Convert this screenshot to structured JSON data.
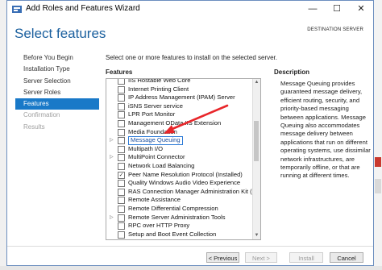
{
  "window": {
    "title": "Add Roles and Features Wizard",
    "page_title": "Select features",
    "destination_label": "DESTINATION SERVER",
    "controls": {
      "minimize": "—",
      "maximize": "☐",
      "close": "✕"
    }
  },
  "nav": {
    "items": [
      {
        "label": "Before You Begin",
        "state": "normal"
      },
      {
        "label": "Installation Type",
        "state": "normal"
      },
      {
        "label": "Server Selection",
        "state": "normal"
      },
      {
        "label": "Server Roles",
        "state": "normal"
      },
      {
        "label": "Features",
        "state": "selected"
      },
      {
        "label": "Confirmation",
        "state": "disabled"
      },
      {
        "label": "Results",
        "state": "disabled"
      }
    ]
  },
  "main": {
    "instruction": "Select one or more features to install on the selected server.",
    "features_header": "Features",
    "description_header": "Description",
    "description_text": "Message Queuing provides guaranteed message delivery, efficient routing, security, and priority-based messaging between applications. Message Queuing also accommodates message delivery between applications that run on different operating systems, use dissimilar network infrastructures, are temporarily offline, or that are running at different times."
  },
  "features": [
    {
      "label": "IIS Hostable Web Core",
      "checked": false,
      "expandable": false
    },
    {
      "label": "Internet Printing Client",
      "checked": false,
      "expandable": false
    },
    {
      "label": "IP Address Management (IPAM) Server",
      "checked": false,
      "expandable": false
    },
    {
      "label": "iSNS Server service",
      "checked": false,
      "expandable": false
    },
    {
      "label": "LPR Port Monitor",
      "checked": false,
      "expandable": false
    },
    {
      "label": "Management OData IIS Extension",
      "checked": false,
      "expandable": false
    },
    {
      "label": "Media Foundation",
      "checked": false,
      "expandable": false
    },
    {
      "label": "Message Queuing",
      "checked": false,
      "expandable": true,
      "highlighted": true
    },
    {
      "label": "Multipath I/O",
      "checked": false,
      "expandable": false
    },
    {
      "label": "MultiPoint Connector",
      "checked": false,
      "expandable": true
    },
    {
      "label": "Network Load Balancing",
      "checked": false,
      "expandable": false
    },
    {
      "label": "Peer Name Resolution Protocol (Installed)",
      "checked": true,
      "expandable": false
    },
    {
      "label": "Quality Windows Audio Video Experience",
      "checked": false,
      "expandable": false
    },
    {
      "label": "RAS Connection Manager Administration Kit (CMA",
      "checked": false,
      "expandable": false
    },
    {
      "label": "Remote Assistance",
      "checked": false,
      "expandable": false
    },
    {
      "label": "Remote Differential Compression",
      "checked": false,
      "expandable": false
    },
    {
      "label": "Remote Server Administration Tools",
      "checked": false,
      "expandable": true
    },
    {
      "label": "RPC over HTTP Proxy",
      "checked": false,
      "expandable": false
    },
    {
      "label": "Setup and Boot Event Collection",
      "checked": false,
      "expandable": false
    }
  ],
  "buttons": {
    "previous": "< Previous",
    "next": "Next >",
    "install": "Install",
    "cancel": "Cancel"
  },
  "annotation": {
    "arrow_color": "#e8262a"
  },
  "colors": {
    "accent": "#1979c8",
    "title": "#1a5f9e"
  }
}
